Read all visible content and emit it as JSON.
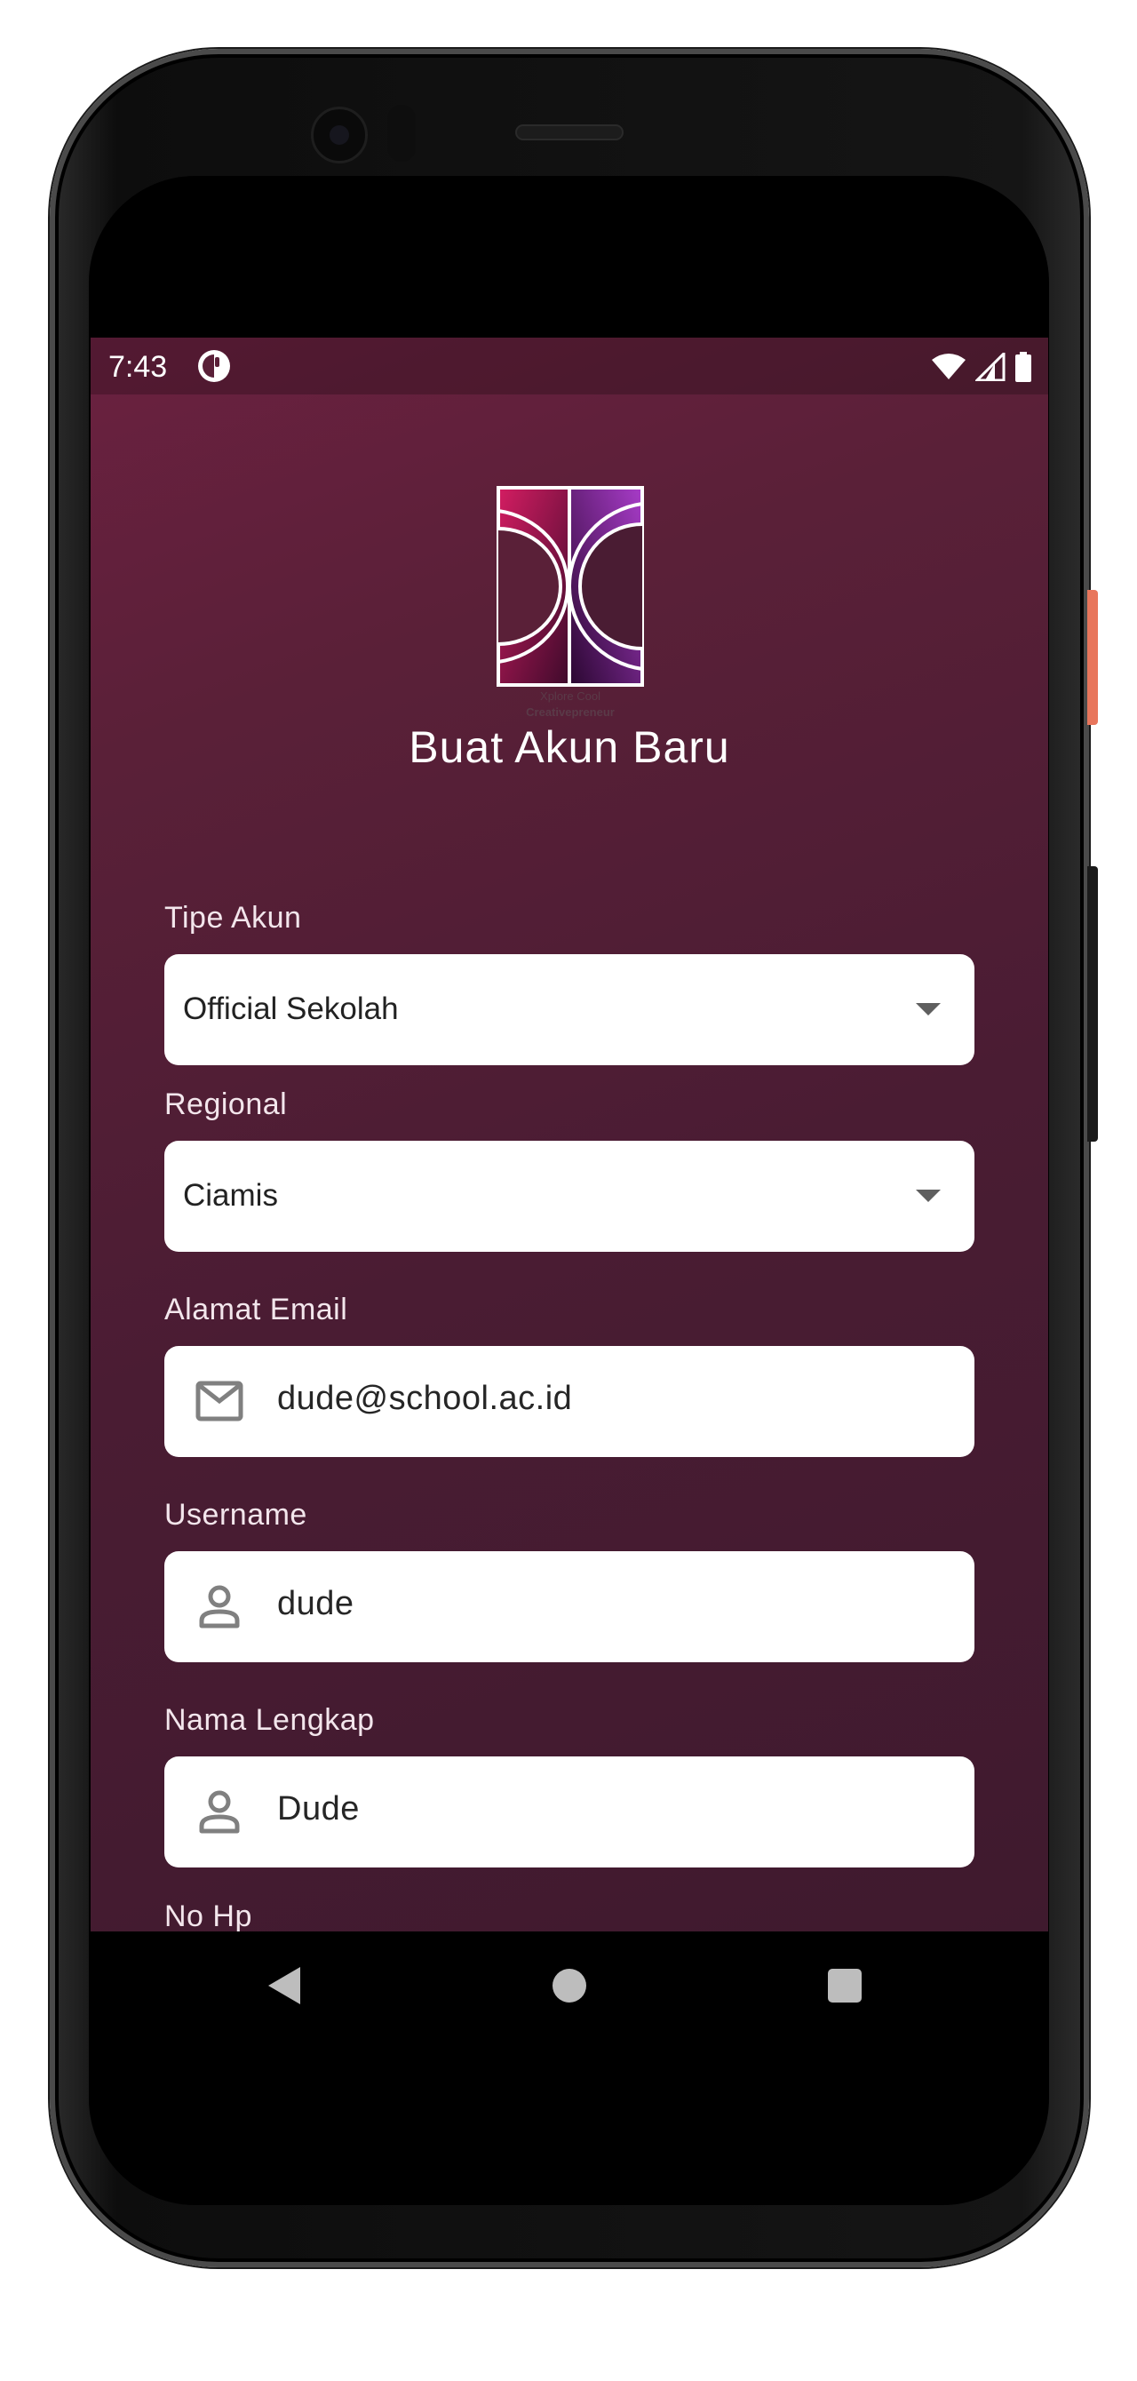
{
  "status_bar": {
    "time": "7:43"
  },
  "header": {
    "title": "Buat Akun Baru",
    "logo_caption_line1": "Xplore Cool",
    "logo_caption_line2": "Creativepreneur"
  },
  "form": {
    "account_type": {
      "label": "Tipe Akun",
      "value": "Official Sekolah"
    },
    "region": {
      "label": "Regional",
      "value": "Ciamis"
    },
    "email": {
      "label": "Alamat Email",
      "value": "dude@school.ac.id"
    },
    "username": {
      "label": "Username",
      "value": "dude"
    },
    "full_name": {
      "label": "Nama Lengkap",
      "value": "Dude"
    },
    "phone": {
      "label": "No Hp"
    }
  },
  "colors": {
    "background_top": "#6b2140",
    "background_bottom": "#3f1a2e",
    "field_background": "#ffffff",
    "label_text": "#f3e6ec"
  }
}
